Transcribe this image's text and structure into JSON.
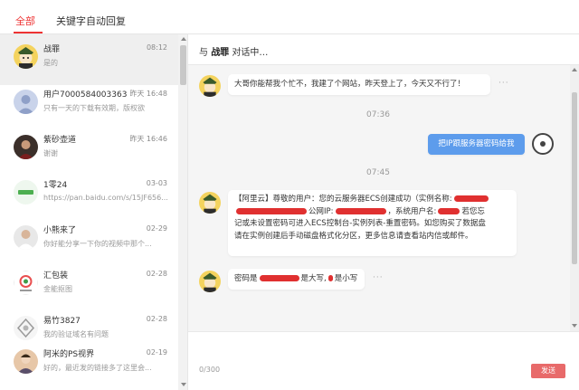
{
  "tabs": [
    {
      "label": "全部",
      "active": true
    },
    {
      "label": "关键字自动回复",
      "active": false
    }
  ],
  "conversations": [
    {
      "name": "战罪",
      "time": "08:12",
      "preview": "是的",
      "active": true,
      "avatar": "cartoon-avatar"
    },
    {
      "name": "用户7000584003363",
      "time": "昨天 16:48",
      "preview": "只有一天的下载有效期，版权欲",
      "active": false,
      "avatar": "default-avatar"
    },
    {
      "name": "紫砂壶道",
      "time": "昨天 16:46",
      "preview": "谢谢",
      "active": false,
      "avatar": "photo-avatar"
    },
    {
      "name": "1零24",
      "time": "03-03",
      "preview": "https://pan.baidu.com/s/15JF656...",
      "active": false,
      "avatar": "green-logo-avatar"
    },
    {
      "name": "小熊来了",
      "time": "02-29",
      "preview": "你好能分享一下你的视频中那个...",
      "active": false,
      "avatar": "person-avatar"
    },
    {
      "name": "汇包装",
      "time": "02-28",
      "preview": "金能抠图",
      "active": false,
      "avatar": "brand-logo-avatar"
    },
    {
      "name": "易竹3827",
      "time": "02-28",
      "preview": "我的验证域名有问题",
      "active": false,
      "avatar": "grey-pattern-avatar"
    },
    {
      "name": "阿米的PS视界",
      "time": "02-19",
      "preview": "好的，最近发的链接多了这里会...",
      "active": false,
      "avatar": "person-avatar-2"
    }
  ],
  "chat": {
    "title_prefix": "与",
    "contact": "战罪",
    "title_suffix": "对话中…",
    "messages": [
      {
        "type": "in",
        "text": "大哥你能帮我个忙不，我建了个网站，昨天登上了，今天又不行了！"
      },
      {
        "type": "time",
        "text": "07:36"
      },
      {
        "type": "out",
        "text": "把IP跟服务器密码给我"
      },
      {
        "type": "time",
        "text": "07:45"
      },
      {
        "type": "in",
        "lines": [
          "【阿里云】尊敬的用户：您的云服务器ECS创建成功（实例名称:",
          "公网IP:",
          "，系统用户名:",
          "若您忘",
          "记或未设置密码可进入ECS控制台-实例列表-重置密码。如您购买了数据盘",
          "请在实例创建后手动磁盘格式化分区，更多信息请查看站内信或邮件。"
        ]
      },
      {
        "type": "in",
        "parts": [
          "密码是",
          "是大写,",
          "是小写"
        ]
      }
    ],
    "more": "···"
  },
  "input": {
    "counter": "0/300",
    "send_label": "发送"
  },
  "colors": {
    "accent": "#e33333",
    "outgoing_bubble": "#5d9cec",
    "send_button": "#e86a6a",
    "redaction": "#e03030"
  }
}
